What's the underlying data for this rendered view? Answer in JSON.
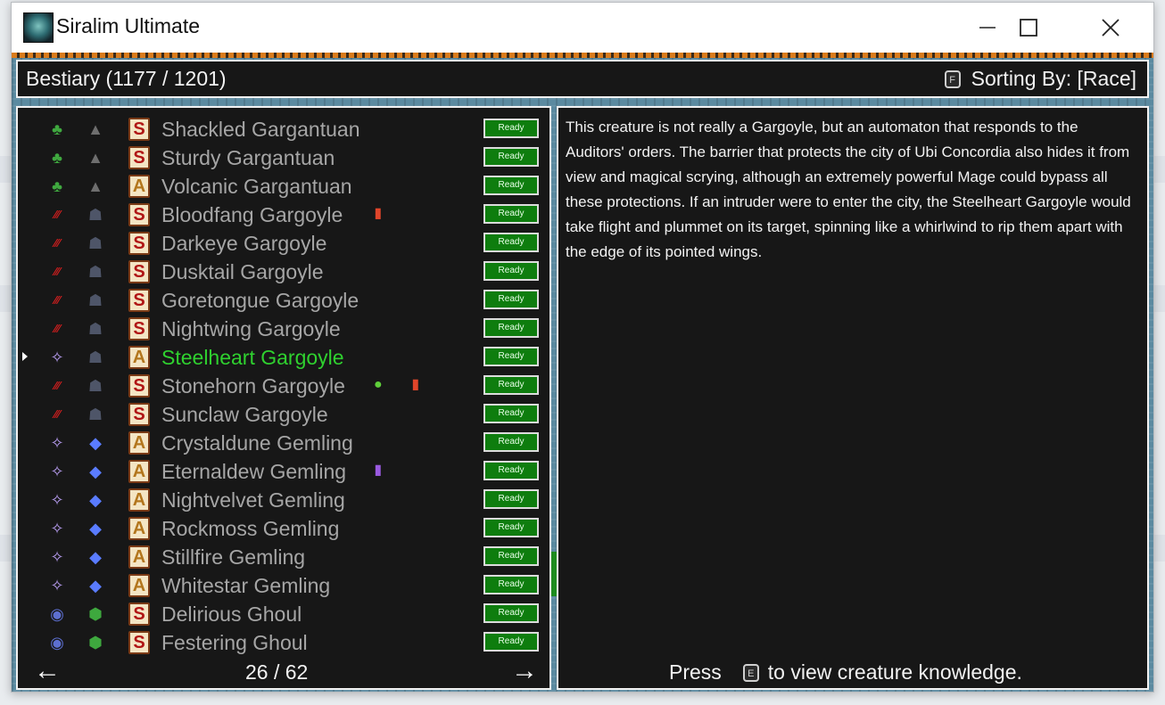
{
  "window": {
    "title": "Siralim Ultimate",
    "controls": [
      "minimize-icon",
      "maximize-icon",
      "close-icon"
    ]
  },
  "header": {
    "bestiary_title": "Bestiary (1177 / 1201)",
    "sort_key": "F",
    "sorting_label": "Sorting By: [Race]"
  },
  "list": {
    "rows": [
      {
        "name": "Shackled Gargantuan",
        "class": "S",
        "trait_icon": "leaf-icon",
        "race_icon": "rock-pile-icon",
        "status": "Ready"
      },
      {
        "name": "Sturdy Gargantuan",
        "class": "S",
        "trait_icon": "leaf-icon",
        "race_icon": "rock-pile-icon",
        "status": "Ready"
      },
      {
        "name": "Volcanic Gargantuan",
        "class": "A",
        "trait_icon": "leaf-icon",
        "race_icon": "rock-pile-icon",
        "status": "Ready"
      },
      {
        "name": "Bloodfang Gargoyle",
        "class": "S",
        "trait_icon": "claw-marks-icon",
        "race_icon": "gargoyle-icon",
        "badges": [
          "red-card-icon"
        ],
        "status": "Ready"
      },
      {
        "name": "Darkeye Gargoyle",
        "class": "S",
        "trait_icon": "claw-marks-icon",
        "race_icon": "gargoyle-icon",
        "status": "Ready"
      },
      {
        "name": "Dusktail Gargoyle",
        "class": "S",
        "trait_icon": "claw-marks-icon",
        "race_icon": "gargoyle-icon",
        "status": "Ready"
      },
      {
        "name": "Goretongue Gargoyle",
        "class": "S",
        "trait_icon": "claw-marks-icon",
        "race_icon": "gargoyle-icon",
        "status": "Ready"
      },
      {
        "name": "Nightwing Gargoyle",
        "class": "S",
        "trait_icon": "claw-marks-icon",
        "race_icon": "gargoyle-icon",
        "status": "Ready"
      },
      {
        "name": "Steelheart Gargoyle",
        "class": "A",
        "trait_icon": "sparkles-icon",
        "race_icon": "gargoyle-icon",
        "status": "Ready",
        "selected": true
      },
      {
        "name": "Stonehorn Gargoyle",
        "class": "S",
        "trait_icon": "claw-marks-icon",
        "race_icon": "gargoyle-icon",
        "badges": [
          "green-creature-icon",
          "red-card-icon"
        ],
        "status": "Ready"
      },
      {
        "name": "Sunclaw Gargoyle",
        "class": "S",
        "trait_icon": "claw-marks-icon",
        "race_icon": "gargoyle-icon",
        "status": "Ready"
      },
      {
        "name": "Crystaldune Gemling",
        "class": "A",
        "trait_icon": "sparkles-icon",
        "race_icon": "gem-icon",
        "status": "Ready"
      },
      {
        "name": "Eternaldew Gemling",
        "class": "A",
        "trait_icon": "sparkles-icon",
        "race_icon": "gem-icon",
        "badges": [
          "purple-card-icon"
        ],
        "status": "Ready"
      },
      {
        "name": "Nightvelvet Gemling",
        "class": "A",
        "trait_icon": "sparkles-icon",
        "race_icon": "gem-icon",
        "status": "Ready"
      },
      {
        "name": "Rockmoss Gemling",
        "class": "A",
        "trait_icon": "sparkles-icon",
        "race_icon": "gem-icon",
        "status": "Ready"
      },
      {
        "name": "Stillfire Gemling",
        "class": "A",
        "trait_icon": "sparkles-icon",
        "race_icon": "gem-icon",
        "status": "Ready"
      },
      {
        "name": "Whitestar Gemling",
        "class": "A",
        "trait_icon": "sparkles-icon",
        "race_icon": "gem-icon",
        "status": "Ready"
      },
      {
        "name": "Delirious Ghoul",
        "class": "S",
        "trait_icon": "skull-orb-icon",
        "race_icon": "ghoul-head-icon",
        "status": "Ready"
      },
      {
        "name": "Festering Ghoul",
        "class": "S",
        "trait_icon": "skull-orb-icon",
        "race_icon": "ghoul-head-icon",
        "status": "Ready"
      }
    ],
    "page_indicator": "26 / 62"
  },
  "detail": {
    "description": "This creature is not really a Gargoyle, but an automaton that responds to the Auditors' orders. The barrier that protects the city of Ubi Concordia also hides it from view and magical scrying, although an extremely powerful Mage could bypass all these protections. If an intruder were to enter the city, the Steelheart Gargoyle would take flight and plummet on its target, spinning like a whirlwind to rip them apart with the edge of its pointed wings.",
    "press_label": "Press",
    "knowledge_key": "E",
    "knowledge_label": "to view creature knowledge."
  },
  "colors": {
    "selected_name": "#2fd12f",
    "unselected_name": "#a6a6a6",
    "ready_green": "#0e7d0e",
    "panel_bg": "#171717"
  }
}
